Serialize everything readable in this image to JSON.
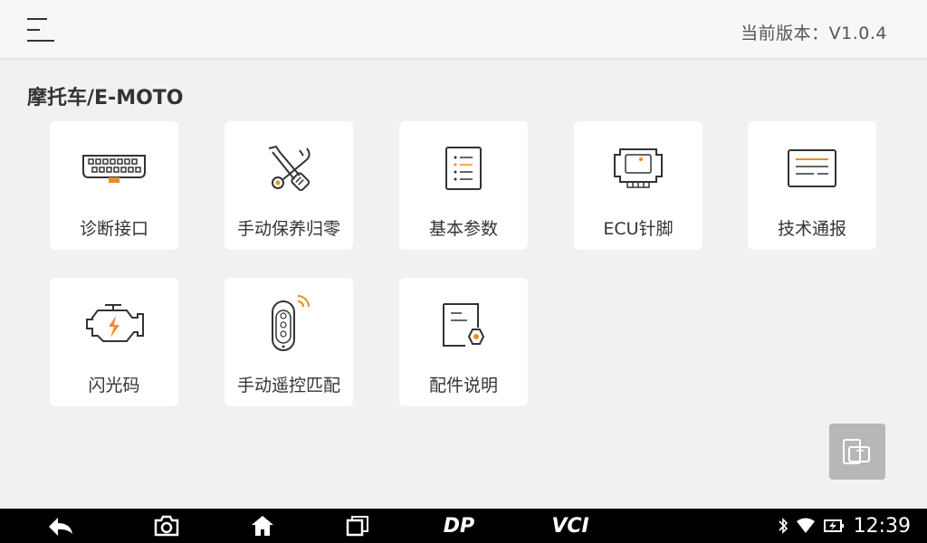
{
  "header": {
    "menu_icon": "hamburger-menu-icon",
    "version_text": "当前版本：V1.0.4"
  },
  "section": {
    "title": "摩托车/E-MOTO"
  },
  "cards": [
    {
      "label": "诊断接口",
      "icon": "obd-connector-icon"
    },
    {
      "label": "手动保养归零",
      "icon": "wrench-screwdriver-icon"
    },
    {
      "label": "基本参数",
      "icon": "parameter-list-icon"
    },
    {
      "label": "ECU针脚",
      "icon": "ecu-module-icon"
    },
    {
      "label": "技术通报",
      "icon": "technical-bulletin-icon"
    },
    {
      "label": "闪光码",
      "icon": "engine-flash-icon"
    },
    {
      "label": "手动遥控匹配",
      "icon": "remote-key-icon"
    },
    {
      "label": "配件说明",
      "icon": "parts-document-icon"
    }
  ],
  "floating_button": {
    "icon": "screen-switch-icon"
  },
  "navbar": {
    "buttons": [
      "back-icon",
      "camera-icon",
      "home-icon",
      "recent-apps-icon",
      "dp-icon",
      "vci-icon"
    ],
    "dp_text": "DP",
    "vci_text": "VCI",
    "time": "12:39"
  },
  "colors": {
    "accent": "#f08a24",
    "background": "#f1f1f1",
    "card": "#ffffff",
    "navbar": "#000000"
  }
}
